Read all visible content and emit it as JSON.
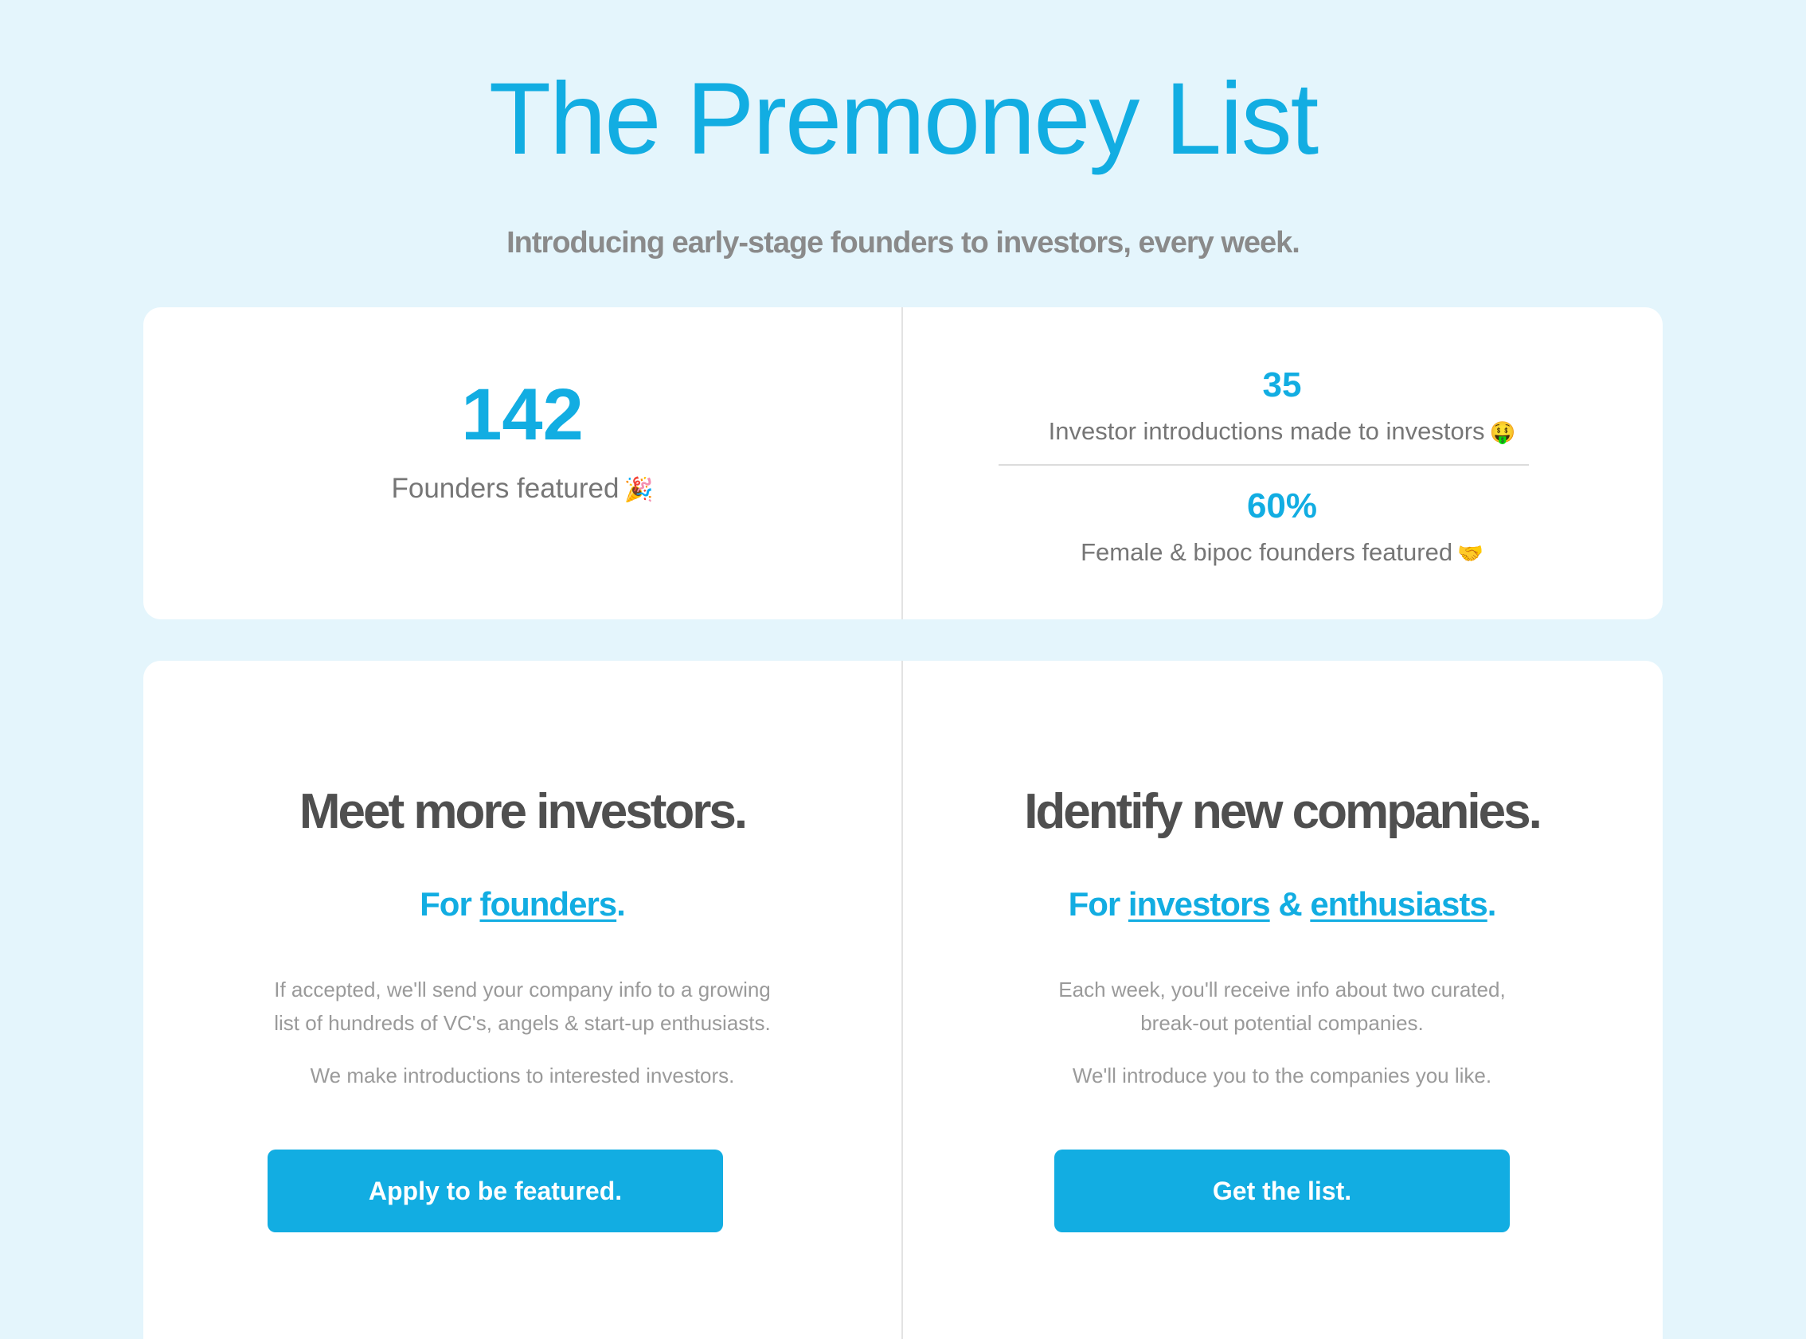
{
  "header": {
    "title": "The Premoney List",
    "tagline": "Introducing early-stage founders to investors, every week."
  },
  "stats": {
    "founders": {
      "value": "142",
      "label": "Founders featured",
      "emoji": "🎉"
    },
    "introductions": {
      "value": "35",
      "label": "Investor introductions made to investors",
      "emoji": "🤑"
    },
    "diversity": {
      "value": "60%",
      "label": "Female & bipoc founders featured",
      "emoji": "🤝"
    }
  },
  "founders_section": {
    "heading": "Meet more investors.",
    "sub_prefix": "For ",
    "sub_link": "founders",
    "sub_suffix": ".",
    "desc_line1": "If accepted, we'll send your company info to a growing list of hundreds of VC's, angels & start-up enthusiasts.",
    "desc_line2": "We make introductions to interested investors.",
    "button_label": "Apply to be featured."
  },
  "investors_section": {
    "heading": "Identify new companies.",
    "sub_prefix": "For ",
    "sub_link1": "investors",
    "sub_mid": " & ",
    "sub_link2": "enthusiasts",
    "sub_suffix": ".",
    "desc_line1": "Each week, you'll receive info about two curated, break-out potential companies.",
    "desc_line2": "We'll introduce you to the companies you like.",
    "button_label": "Get the list."
  },
  "colors": {
    "accent": "#12ade2",
    "background": "#e4f5fc",
    "heading_gray": "#4f4f4f"
  }
}
